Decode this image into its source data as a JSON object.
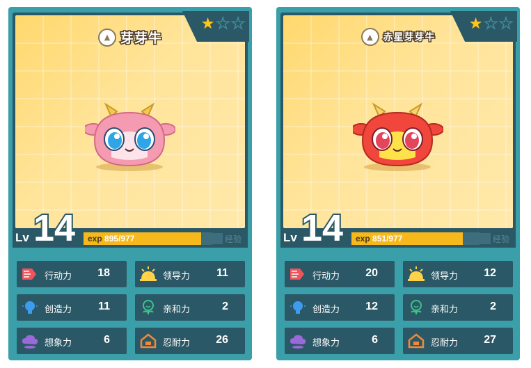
{
  "cards": [
    {
      "name": "芽芽牛",
      "stars": {
        "filled": 1,
        "total": 3
      },
      "level": "14",
      "level_label": "Lv",
      "exp_label": "exp",
      "exp_current": "895",
      "exp_max": "/977",
      "exp_fraction": 0.916,
      "exp_button": "经验",
      "body_color": "#f49bb1",
      "eye_color": "#2ea5e6",
      "stats": [
        {
          "label": "行动力",
          "value": "18",
          "icon": "speed-icon"
        },
        {
          "label": "领导力",
          "value": "11",
          "icon": "sun-icon"
        },
        {
          "label": "创造力",
          "value": "11",
          "icon": "bulb-icon"
        },
        {
          "label": "亲和力",
          "value": "2",
          "icon": "sprout-face-icon"
        },
        {
          "label": "想象力",
          "value": "6",
          "icon": "cloud-icon"
        },
        {
          "label": "忍耐力",
          "value": "26",
          "icon": "house-icon"
        }
      ]
    },
    {
      "name": "赤星芽芽牛",
      "stars": {
        "filled": 1,
        "total": 3
      },
      "level": "14",
      "level_label": "Lv",
      "exp_label": "exp",
      "exp_current": "851",
      "exp_max": "/977",
      "exp_fraction": 0.871,
      "exp_button": "经验",
      "body_color": "#f0463c",
      "eye_color": "#e4455a",
      "stats": [
        {
          "label": "行动力",
          "value": "20",
          "icon": "speed-icon"
        },
        {
          "label": "领导力",
          "value": "12",
          "icon": "sun-icon"
        },
        {
          "label": "创造力",
          "value": "12",
          "icon": "bulb-icon"
        },
        {
          "label": "亲和力",
          "value": "2",
          "icon": "sprout-face-icon"
        },
        {
          "label": "想象力",
          "value": "6",
          "icon": "cloud-icon"
        },
        {
          "label": "忍耐力",
          "value": "27",
          "icon": "house-icon"
        }
      ]
    }
  ]
}
